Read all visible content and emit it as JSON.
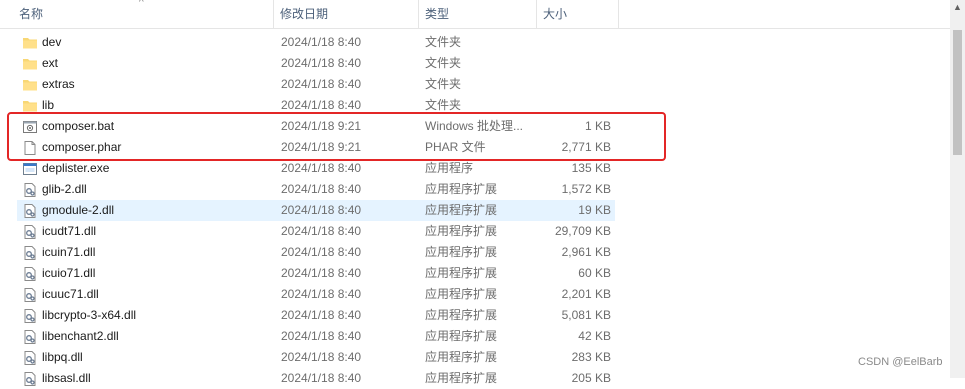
{
  "columns": {
    "name": "名称",
    "date": "修改日期",
    "type": "类型",
    "size": "大小"
  },
  "sort_indicator": "^",
  "files": [
    {
      "name": "dev",
      "date": "2024/1/18 8:40",
      "type": "文件夹",
      "size": "",
      "icon": "folder-icon"
    },
    {
      "name": "ext",
      "date": "2024/1/18 8:40",
      "type": "文件夹",
      "size": "",
      "icon": "folder-icon"
    },
    {
      "name": "extras",
      "date": "2024/1/18 8:40",
      "type": "文件夹",
      "size": "",
      "icon": "folder-icon"
    },
    {
      "name": "lib",
      "date": "2024/1/18 8:40",
      "type": "文件夹",
      "size": "",
      "icon": "folder-icon"
    },
    {
      "name": "composer.bat",
      "date": "2024/1/18 9:21",
      "type": "Windows 批处理...",
      "size": "1 KB",
      "icon": "batch-file-icon"
    },
    {
      "name": "composer.phar",
      "date": "2024/1/18 9:21",
      "type": "PHAR 文件",
      "size": "2,771 KB",
      "icon": "file-icon"
    },
    {
      "name": "deplister.exe",
      "date": "2024/1/18 8:40",
      "type": "应用程序",
      "size": "135 KB",
      "icon": "exe-icon"
    },
    {
      "name": "glib-2.dll",
      "date": "2024/1/18 8:40",
      "type": "应用程序扩展",
      "size": "1,572 KB",
      "icon": "dll-icon"
    },
    {
      "name": "gmodule-2.dll",
      "date": "2024/1/18 8:40",
      "type": "应用程序扩展",
      "size": "19 KB",
      "icon": "dll-icon",
      "selected": true
    },
    {
      "name": "icudt71.dll",
      "date": "2024/1/18 8:40",
      "type": "应用程序扩展",
      "size": "29,709 KB",
      "icon": "dll-icon"
    },
    {
      "name": "icuin71.dll",
      "date": "2024/1/18 8:40",
      "type": "应用程序扩展",
      "size": "2,961 KB",
      "icon": "dll-icon"
    },
    {
      "name": "icuio71.dll",
      "date": "2024/1/18 8:40",
      "type": "应用程序扩展",
      "size": "60 KB",
      "icon": "dll-icon"
    },
    {
      "name": "icuuc71.dll",
      "date": "2024/1/18 8:40",
      "type": "应用程序扩展",
      "size": "2,201 KB",
      "icon": "dll-icon"
    },
    {
      "name": "libcrypto-3-x64.dll",
      "date": "2024/1/18 8:40",
      "type": "应用程序扩展",
      "size": "5,081 KB",
      "icon": "dll-icon"
    },
    {
      "name": "libenchant2.dll",
      "date": "2024/1/18 8:40",
      "type": "应用程序扩展",
      "size": "42 KB",
      "icon": "dll-icon"
    },
    {
      "name": "libpq.dll",
      "date": "2024/1/18 8:40",
      "type": "应用程序扩展",
      "size": "283 KB",
      "icon": "dll-icon"
    },
    {
      "name": "libsasl.dll",
      "date": "2024/1/18 8:40",
      "type": "应用程序扩展",
      "size": "205 KB",
      "icon": "dll-icon"
    }
  ],
  "highlight_color": "#e32626",
  "watermark": "CSDN @EelBarb"
}
